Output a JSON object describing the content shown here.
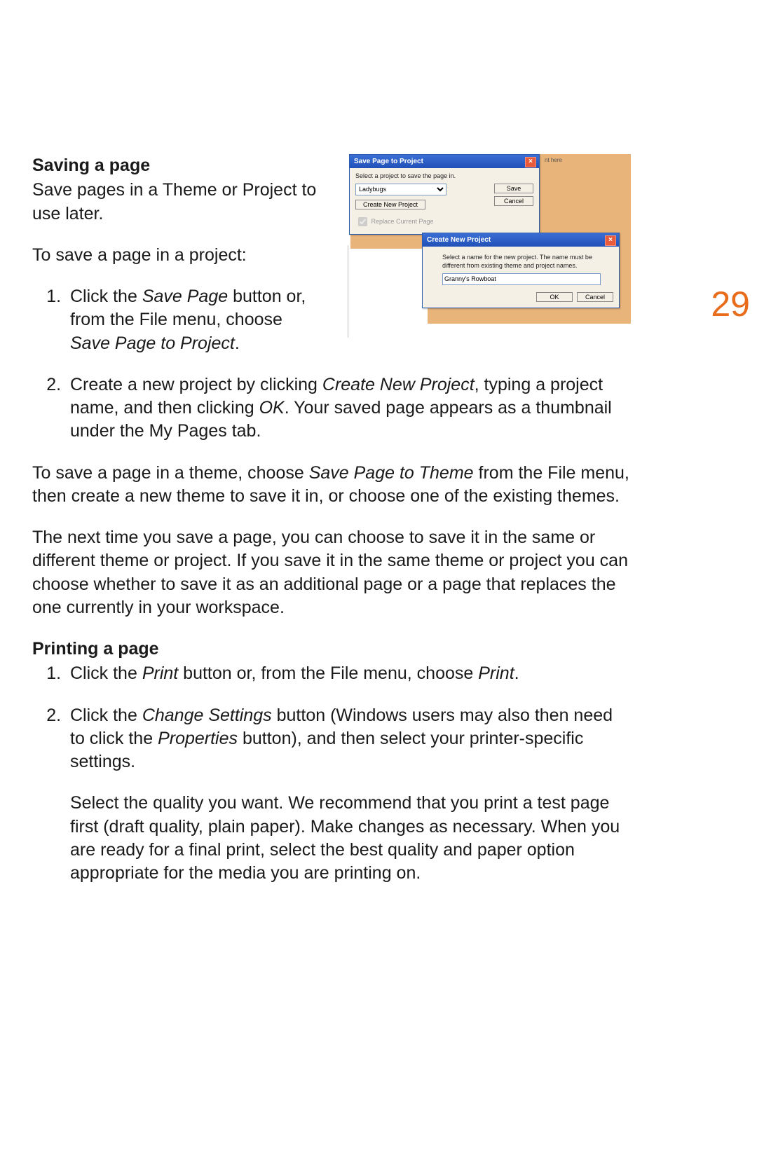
{
  "pageNumber": "29",
  "section1": {
    "heading": "Saving a page",
    "intro": "Save pages in a Theme or Project to use later.",
    "toSave": "To save a page in a project:",
    "steps": [
      {
        "pre": "Click the ",
        "em1": "Save Page",
        "mid": " button or, from the File menu, choose ",
        "em2": "Save Page to Project",
        "post": "."
      },
      {
        "pre": "Create a new project by clicking ",
        "em1": "Create New Project",
        "mid": ", typing a project name, and then clicking ",
        "em2": "OK",
        "post": ". Your saved page appears as a thumbnail under the My Pages tab."
      }
    ],
    "themePara": {
      "pre": "To save a page in a theme, choose ",
      "em": "Save Page to Theme",
      "post": " from the File menu, then create a new theme to save it in, or choose one of the existing themes."
    },
    "nextPara": "The next time you save a page, you can choose to save it in the same or different theme or project. If you save it in the same theme or project you can choose whether to save it as an additional page or a page that replaces the one currently in your workspace."
  },
  "section2": {
    "heading": "Printing a page",
    "steps": [
      {
        "pre": "Click the ",
        "em1": "Print",
        "mid": " button or, from the File menu, choose ",
        "em2": "Print",
        "post": "."
      },
      {
        "pre": "Click the ",
        "em1": "Change Settings",
        "mid": " button (Windows users may also then need to click the ",
        "em2": "Properties",
        "post": " button), and then select your printer-specific settings.",
        "sub": "Select the quality you want. We recommend that you print a test page first (draft quality, plain paper). Make changes as necessary. When you are ready for a final print, select the best quality and paper option appropriate for the media you are printing on."
      }
    ]
  },
  "figure": {
    "bgSnippet": "nt here",
    "dialog1": {
      "title": "Save Page to Project",
      "prompt": "Select a project to save the page in.",
      "selected": "Ladybugs",
      "createBtn": "Create New Project",
      "saveBtn": "Save",
      "cancelBtn": "Cancel",
      "replaceChk": "Replace Current Page"
    },
    "dialog2": {
      "title": "Create New Project",
      "prompt": "Select a name for the new project. The name must be different from existing theme and project names.",
      "value": "Granny's Rowboat",
      "okBtn": "OK",
      "cancelBtn": "Cancel"
    }
  }
}
